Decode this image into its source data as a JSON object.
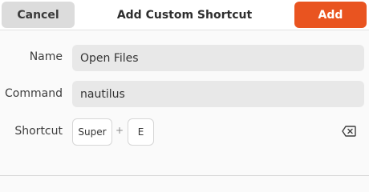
{
  "header": {
    "cancel_label": "Cancel",
    "title": "Add Custom Shortcut",
    "add_label": "Add"
  },
  "form": {
    "name_label": "Name",
    "name_value": "Open Files",
    "command_label": "Command",
    "command_value": "nautilus",
    "shortcut_label": "Shortcut",
    "shortcut_keys": [
      "Super",
      "E"
    ],
    "key_separator": "+"
  },
  "icons": {
    "clear": "backspace-icon"
  },
  "colors": {
    "accent": "#e95420",
    "field_bg": "#e8e8e8",
    "cancel_bg": "#dcdcdc"
  }
}
